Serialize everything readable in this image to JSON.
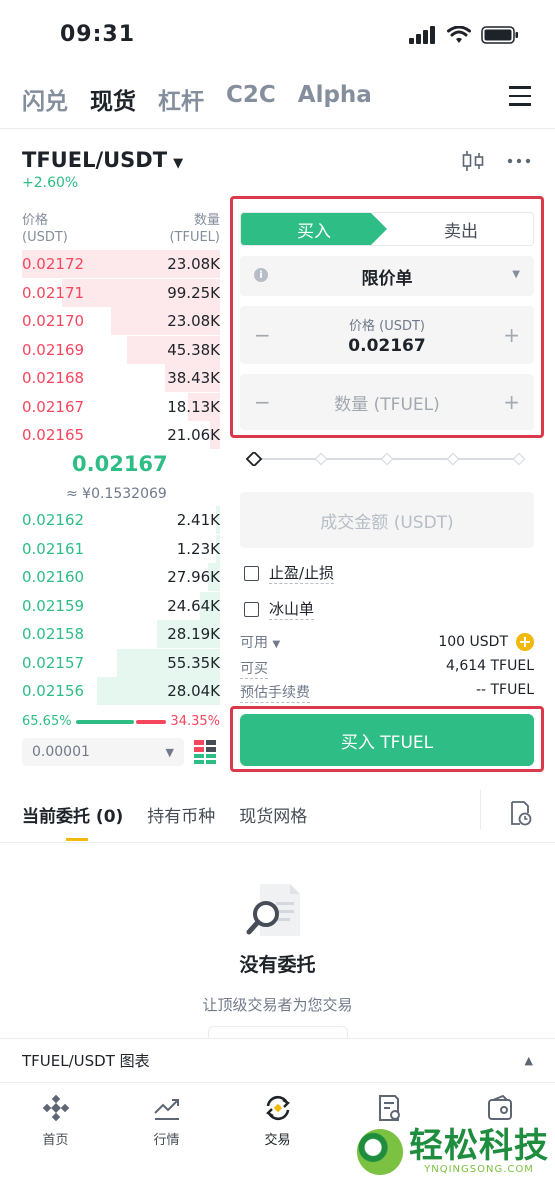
{
  "status_bar": {
    "time": "09:31"
  },
  "top_nav": {
    "items": [
      "闪兑",
      "现货",
      "杠杆",
      "C2C",
      "Alpha"
    ],
    "active": "现货"
  },
  "pair": {
    "name": "TFUEL/USDT",
    "change": "+2.60%"
  },
  "orderbook": {
    "price_header": "价格",
    "price_unit": "(USDT)",
    "qty_header": "数量",
    "qty_unit": "(TFUEL)",
    "asks": [
      {
        "price": "0.02172",
        "qty": "23.08K",
        "depth": 1.0
      },
      {
        "price": "0.02171",
        "qty": "99.25K",
        "depth": 0.8
      },
      {
        "price": "0.02170",
        "qty": "23.08K",
        "depth": 0.55
      },
      {
        "price": "0.02169",
        "qty": "45.38K",
        "depth": 0.47
      },
      {
        "price": "0.02168",
        "qty": "38.43K",
        "depth": 0.28
      },
      {
        "price": "0.02167",
        "qty": "18.13K",
        "depth": 0.16
      },
      {
        "price": "0.02165",
        "qty": "21.06K",
        "depth": 0.05
      }
    ],
    "last_price": "0.02167",
    "last_price_cny": "≈ ¥0.1532069",
    "bids": [
      {
        "price": "0.02162",
        "qty": "2.41K",
        "depth": 0.02
      },
      {
        "price": "0.02161",
        "qty": "1.23K",
        "depth": 0.02
      },
      {
        "price": "0.02160",
        "qty": "27.96K",
        "depth": 0.06
      },
      {
        "price": "0.02159",
        "qty": "24.64K",
        "depth": 0.1
      },
      {
        "price": "0.02158",
        "qty": "28.19K",
        "depth": 0.32
      },
      {
        "price": "0.02157",
        "qty": "55.35K",
        "depth": 0.52
      },
      {
        "price": "0.02156",
        "qty": "28.04K",
        "depth": 0.62
      }
    ],
    "buy_ratio": "65.65%",
    "sell_ratio": "34.35%",
    "buy_ratio_value": 0.6565,
    "precision": "0.00001"
  },
  "trade_form": {
    "buy_tab": "买入",
    "sell_tab": "卖出",
    "order_type": "限价单",
    "price_label": "价格 (USDT)",
    "price_value": "0.02167",
    "qty_placeholder": "数量 (TFUEL)",
    "total_placeholder": "成交金额 (USDT)",
    "tp_sl": "止盈/止损",
    "iceberg": "冰山单",
    "available_label": "可用",
    "available_value": "100 USDT",
    "can_buy_label": "可买",
    "can_buy_value": "4,614 TFUEL",
    "fee_label": "预估手续费",
    "fee_value": "-- TFUEL",
    "buy_button": "买入 TFUEL"
  },
  "orders_tabs": {
    "items": [
      "当前委托 (0)",
      "持有币种",
      "现货网格"
    ]
  },
  "empty_state": {
    "title": "没有委托",
    "subtitle": "让顶级交易者为您交易"
  },
  "chart_toggle": {
    "label": "TFUEL/USDT 图表"
  },
  "bottom_nav": {
    "items": [
      "首页",
      "行情",
      "交易",
      "",
      ""
    ]
  },
  "watermark": {
    "main": "轻松科技",
    "sub": "YNQINGSONG.COM"
  },
  "colors": {
    "green": "#2ebd85",
    "red": "#f6465d",
    "highlight": "#d9394b",
    "yellow": "#f0b90b"
  }
}
